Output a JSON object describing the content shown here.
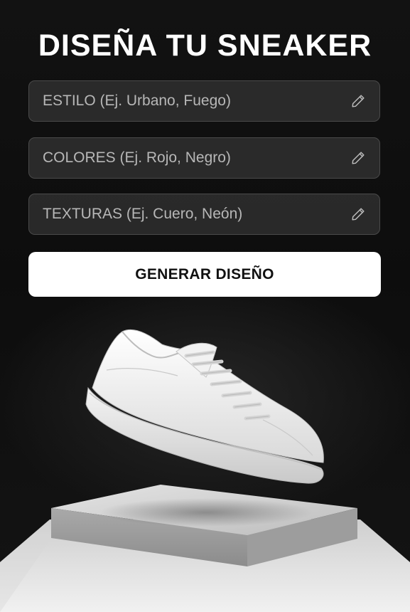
{
  "header": {
    "title": "DISEÑA TU SNEAKER"
  },
  "form": {
    "fields": [
      {
        "placeholder": "ESTILO (Ej. Urbano, Fuego)",
        "value": "",
        "icon": "pencil-icon"
      },
      {
        "placeholder": "COLORES (Ej. Rojo, Negro)",
        "value": "",
        "icon": "pencil-icon"
      },
      {
        "placeholder": "TEXTURAS (Ej. Cuero, Neón)",
        "value": "",
        "icon": "pencil-icon"
      }
    ],
    "submit_label": "GENERAR DISEÑO"
  },
  "colors": {
    "background": "#0c0c0c",
    "accent": "#ffffff",
    "field_background": "#343434",
    "field_border": "#4a4a4a"
  }
}
